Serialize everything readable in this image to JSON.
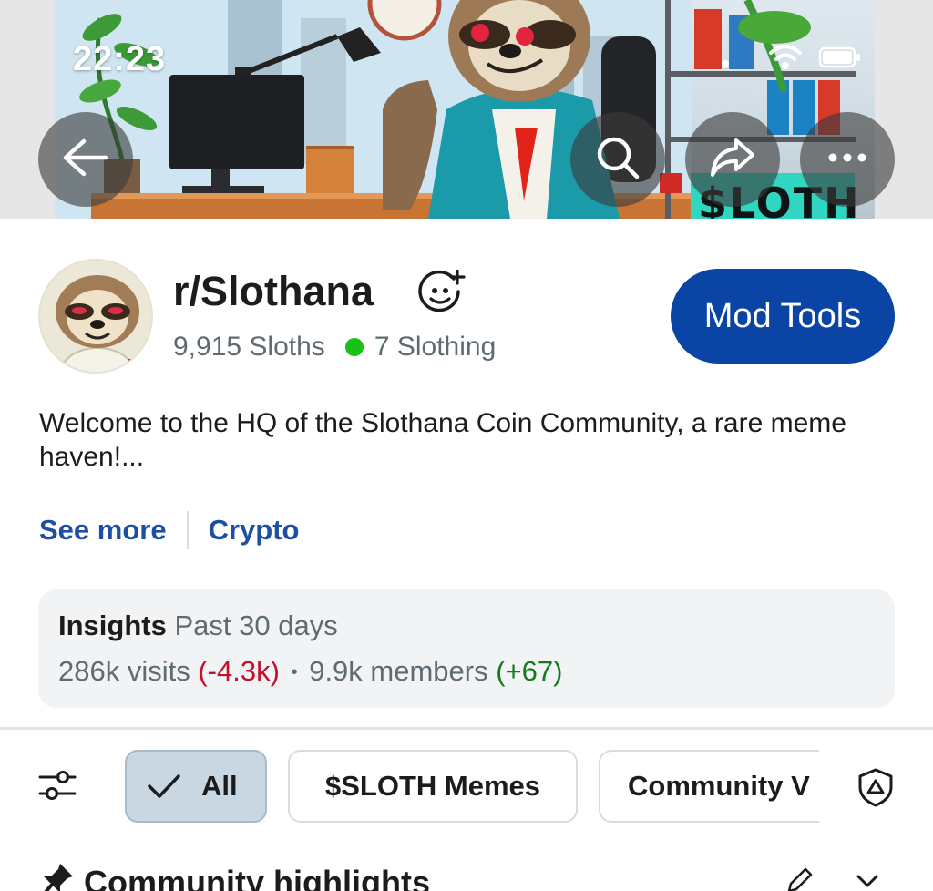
{
  "status_bar": {
    "time": "22:23"
  },
  "banner": {
    "graffiti_text": "$LOTH",
    "back_icon": "arrow-left-icon",
    "search_icon": "search-icon",
    "share_icon": "share-icon",
    "more_icon": "more-horizontal-icon"
  },
  "community": {
    "name": "r/Slothana",
    "members_count": "9,915",
    "members_label": "Sloths",
    "online_count": "7",
    "online_label": "Slothing",
    "mod_tools_label": "Mod Tools",
    "description": "Welcome to the HQ of the Slothana Coin Community, a rare meme haven!...",
    "see_more_label": "See more",
    "topic_label": "Crypto"
  },
  "insights": {
    "title": "Insights",
    "period": "Past 30 days",
    "visits": "286k visits",
    "visits_change": "(-4.3k)",
    "separator": "•",
    "members": "9.9k members",
    "members_change": "(+67)"
  },
  "filters": {
    "chips": [
      {
        "label": "All",
        "selected": true
      },
      {
        "label": "$SLOTH Memes",
        "selected": false
      },
      {
        "label": "Community V",
        "selected": false
      }
    ]
  },
  "highlights": {
    "title": "Community highlights"
  },
  "colors": {
    "accent_blue": "#0a45a5",
    "link_blue": "#1d4fa3",
    "online_green": "#17c217",
    "negative_red": "#c4102a",
    "positive_green": "#157a1c"
  }
}
